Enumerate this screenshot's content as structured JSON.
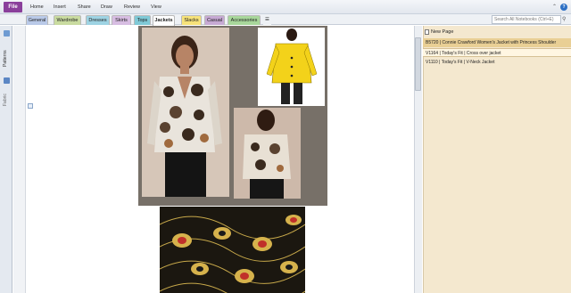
{
  "menubar": {
    "file": "File",
    "items": [
      "Home",
      "Insert",
      "Share",
      "Draw",
      "Review",
      "View"
    ]
  },
  "section_tabs": [
    {
      "label": "General",
      "color": "#b9c9e8"
    },
    {
      "label": "Wardrobe",
      "color": "#c9dba0"
    },
    {
      "label": "Dresses",
      "color": "#9ed3e3"
    },
    {
      "label": "Skirts",
      "color": "#d7bde2"
    },
    {
      "label": "Tops",
      "color": "#7fc9d6"
    },
    {
      "label": "Jackets",
      "color": "#ffffff"
    },
    {
      "label": "Slacks",
      "color": "#f6e27a"
    },
    {
      "label": "Casual",
      "color": "#c6a9d3"
    },
    {
      "label": "Accessories",
      "color": "#a8d79b"
    },
    {
      "label": "☰",
      "color": "#eef1f5"
    }
  ],
  "search": {
    "placeholder": "Search All Notebooks (Ctrl+E)"
  },
  "left_nav": {
    "patterns_label": "Patterns",
    "fabric_label": "Fabric"
  },
  "pages_panel": {
    "new_page_label": "New Page",
    "pages": [
      "B5720 | Connie Crawford Women's Jacket with Princess Shoulder",
      "V1164 | Today's Fit | Cross over jacket",
      "V1110 | Today's Fit | V-Neck Jacket"
    ]
  },
  "colors": {
    "file_button": "#8a3f9b",
    "selected_page": "#e9cf95",
    "panel_bg": "#f4e8cf"
  }
}
